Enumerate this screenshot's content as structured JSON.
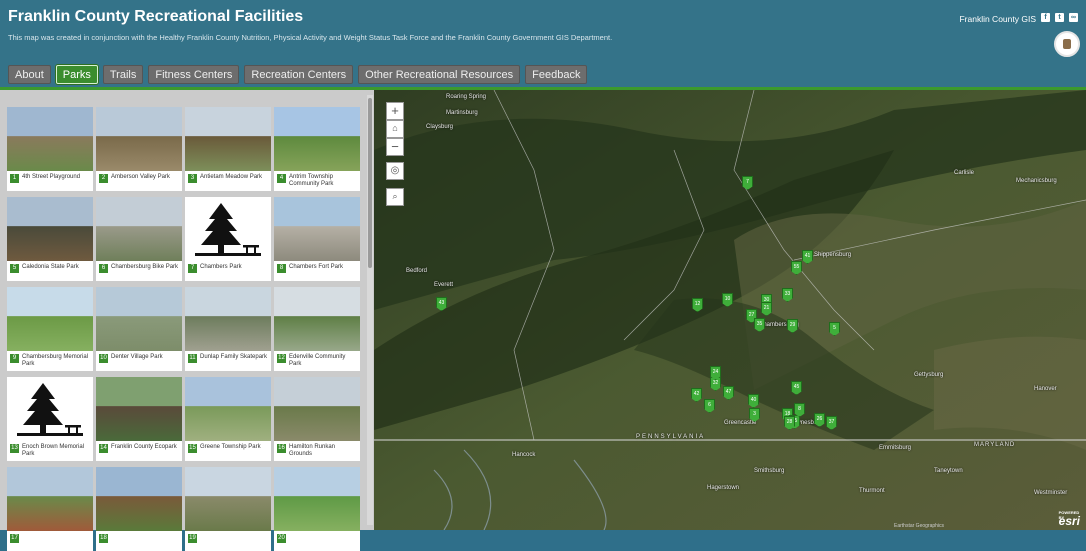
{
  "header": {
    "title": "Franklin County Recreational Facilities",
    "subtitle": "This map was created in conjunction with the Healthy Franklin County Nutrition, Physical Activity and Weight Status Task Force and the Franklin County Government GIS Department.",
    "gis_link": "Franklin County GIS",
    "social_icons": [
      "facebook-icon",
      "twitter-icon",
      "link-icon"
    ]
  },
  "tabs": [
    {
      "label": "About",
      "active": false
    },
    {
      "label": "Parks",
      "active": true
    },
    {
      "label": "Trails",
      "active": false
    },
    {
      "label": "Fitness Centers",
      "active": false
    },
    {
      "label": "Recreation Centers",
      "active": false
    },
    {
      "label": "Other Recreational Resources",
      "active": false
    },
    {
      "label": "Feedback",
      "active": false
    }
  ],
  "parks": [
    {
      "num": "1",
      "name": "4th Street Playground"
    },
    {
      "num": "2",
      "name": "Amberson Valley Park"
    },
    {
      "num": "3",
      "name": "Antietam Meadow Park"
    },
    {
      "num": "4",
      "name": "Antrim Township Community Park"
    },
    {
      "num": "5",
      "name": "Caledonia State Park"
    },
    {
      "num": "6",
      "name": "Chambersburg Bike Park"
    },
    {
      "num": "7",
      "name": "Chambers Park"
    },
    {
      "num": "8",
      "name": "Chambers Fort Park"
    },
    {
      "num": "9",
      "name": "Chambersburg Memorial Park"
    },
    {
      "num": "10",
      "name": "Denter Village Park"
    },
    {
      "num": "11",
      "name": "Dunlap Family Skatepark"
    },
    {
      "num": "12",
      "name": "Edenville Community Park"
    },
    {
      "num": "13",
      "name": "Enoch Brown Memorial Park"
    },
    {
      "num": "14",
      "name": "Franklin County Ecopark"
    },
    {
      "num": "15",
      "name": "Greene Township Park"
    },
    {
      "num": "16",
      "name": "Hamilton Runkan Grounds"
    },
    {
      "num": "17",
      "name": ""
    },
    {
      "num": "18",
      "name": ""
    },
    {
      "num": "19",
      "name": ""
    },
    {
      "num": "20",
      "name": ""
    }
  ],
  "map": {
    "zoom_in": "+",
    "zoom_out": "−",
    "places": [
      "Roaring Spring",
      "Martinsburg",
      "Claysburg",
      "Bedford",
      "Chambersburg",
      "Shippensburg",
      "Gettysburg",
      "Hanover",
      "Greencastle",
      "Waynesboro",
      "Emmitsburg",
      "Taneytown",
      "Smithsburg",
      "Hagerstown",
      "Thurmont",
      "Carlisle",
      "Mechanicsburg",
      "Everett",
      "Hancock",
      "Westminster"
    ],
    "road_label": "PENNSYLVANIA",
    "road_label_right": "MARYLAND",
    "pins": [
      "7",
      "43",
      "55",
      "41",
      "12",
      "10",
      "30",
      "33",
      "21",
      "27",
      "29",
      "5",
      "42",
      "32",
      "24",
      "47",
      "40",
      "45",
      "3",
      "6",
      "18",
      "25",
      "26",
      "37",
      "28",
      "35",
      "8"
    ],
    "attribution": "Earthstar Geographics",
    "esri": "esri",
    "esri_powered": "POWERED BY"
  },
  "colors": {
    "header_bg": "#347389",
    "accent_green": "#3b8d2e",
    "tab_bg": "#6d6d6d"
  }
}
